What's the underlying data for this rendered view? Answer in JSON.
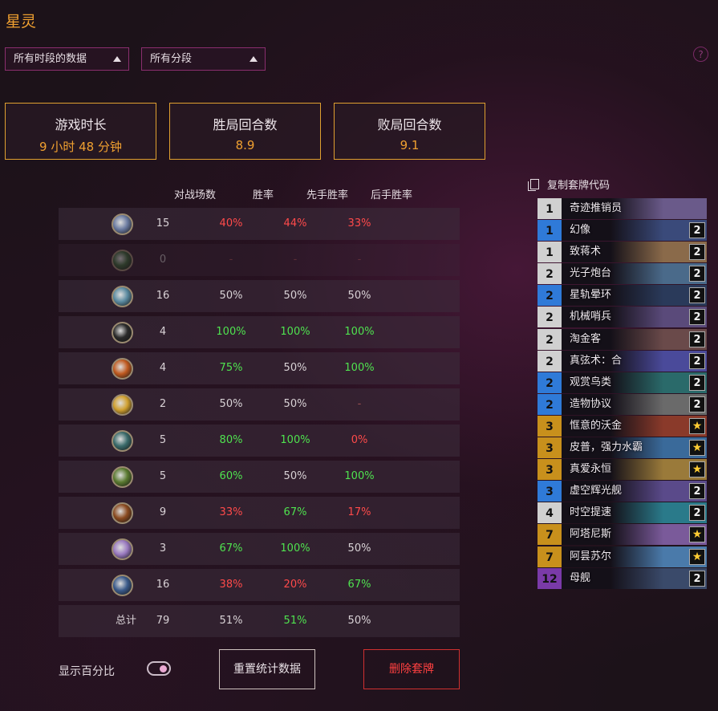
{
  "page": {
    "title": "星灵"
  },
  "filters": {
    "time": "所有时段的数据",
    "rank": "所有分段"
  },
  "help": "?",
  "summary": [
    {
      "label": "游戏时长",
      "value": "9 小时 48 分钟"
    },
    {
      "label": "胜局回合数",
      "value": "8.9"
    },
    {
      "label": "败局回合数",
      "value": "9.1"
    }
  ],
  "table": {
    "headers": {
      "games": "对战场数",
      "winrate": "胜率",
      "first": "先手胜率",
      "second": "后手胜率"
    },
    "rows": [
      {
        "icon": "mage-class-icon",
        "games": "15",
        "winrate": "40%",
        "first": "44%",
        "second": "33%",
        "c": [
          "red",
          "red",
          "red"
        ]
      },
      {
        "icon": "druid-class-icon",
        "games": "0",
        "winrate": "-",
        "first": "-",
        "second": "-",
        "c": [
          "dash",
          "dash",
          "dash"
        ],
        "dim": true
      },
      {
        "icon": "shaman-class-icon",
        "games": "16",
        "winrate": "50%",
        "first": "50%",
        "second": "50%",
        "c": [
          "white",
          "white",
          "white"
        ]
      },
      {
        "icon": "rogue-class-icon",
        "games": "4",
        "winrate": "100%",
        "first": "100%",
        "second": "100%",
        "c": [
          "green",
          "green",
          "green"
        ]
      },
      {
        "icon": "warrior-class-icon",
        "games": "4",
        "winrate": "75%",
        "first": "50%",
        "second": "100%",
        "c": [
          "green",
          "white",
          "green"
        ]
      },
      {
        "icon": "paladin-class-icon",
        "games": "2",
        "winrate": "50%",
        "first": "50%",
        "second": "-",
        "c": [
          "white",
          "white",
          "dash"
        ]
      },
      {
        "icon": "demon-hunter-class-icon",
        "games": "5",
        "winrate": "80%",
        "first": "100%",
        "second": "0%",
        "c": [
          "green",
          "green",
          "red"
        ]
      },
      {
        "icon": "hunter-class-icon",
        "games": "5",
        "winrate": "60%",
        "first": "50%",
        "second": "100%",
        "c": [
          "green",
          "white",
          "green"
        ]
      },
      {
        "icon": "warlock-class-icon",
        "games": "9",
        "winrate": "33%",
        "first": "67%",
        "second": "17%",
        "c": [
          "red",
          "green",
          "red"
        ]
      },
      {
        "icon": "priest-class-icon",
        "games": "3",
        "winrate": "67%",
        "first": "100%",
        "second": "50%",
        "c": [
          "green",
          "green",
          "white"
        ]
      },
      {
        "icon": "death-knight-class-icon",
        "games": "16",
        "winrate": "38%",
        "first": "20%",
        "second": "67%",
        "c": [
          "red",
          "red",
          "green"
        ]
      }
    ],
    "total": {
      "label": "总计",
      "games": "79",
      "winrate": "51%",
      "first": "51%",
      "second": "50%",
      "c": [
        "white",
        "green",
        "white"
      ]
    }
  },
  "deck": {
    "copy_label": "复制套牌代码",
    "cards": [
      {
        "cost": "1",
        "name": "奇迹推销员",
        "count": "",
        "rarity": "common",
        "art": "#6a5a8a"
      },
      {
        "cost": "1",
        "name": "幻像",
        "count": "2",
        "rarity": "rare",
        "art": "#3a4a7a"
      },
      {
        "cost": "1",
        "name": "致蒋术",
        "count": "2",
        "rarity": "common",
        "art": "#8a6a4a"
      },
      {
        "cost": "2",
        "name": "光子炮台",
        "count": "2",
        "rarity": "common",
        "art": "#4a6a8a"
      },
      {
        "cost": "2",
        "name": "星轨晕环",
        "count": "2",
        "rarity": "rare",
        "art": "#2a3a5a"
      },
      {
        "cost": "2",
        "name": "机械哨兵",
        "count": "2",
        "rarity": "common",
        "art": "#5a4a7a"
      },
      {
        "cost": "2",
        "name": "淘金客",
        "count": "2",
        "rarity": "common",
        "art": "#6a4a4a"
      },
      {
        "cost": "2",
        "name": "真弦术：合",
        "count": "2",
        "rarity": "common",
        "art": "#4a4a9a"
      },
      {
        "cost": "2",
        "name": "观赏鸟类",
        "count": "2",
        "rarity": "rare",
        "art": "#2a6a6a"
      },
      {
        "cost": "2",
        "name": "造物协议",
        "count": "2",
        "rarity": "rare",
        "art": "#6a6a6a"
      },
      {
        "cost": "3",
        "name": "恇意的沃金",
        "count": "★",
        "rarity": "legendary",
        "art": "#8a3a2a"
      },
      {
        "cost": "3",
        "name": "皮普，强力水霸",
        "count": "★",
        "rarity": "legendary",
        "art": "#3a6a9a"
      },
      {
        "cost": "3",
        "name": "真爱永恒",
        "count": "★",
        "rarity": "legendary",
        "art": "#9a7a3a"
      },
      {
        "cost": "3",
        "name": "虚空辉光舰",
        "count": "2",
        "rarity": "rare",
        "art": "#5a4a8a"
      },
      {
        "cost": "4",
        "name": "时空提速",
        "count": "2",
        "rarity": "common",
        "art": "#2a7a8a"
      },
      {
        "cost": "7",
        "name": "阿塔尼斯",
        "count": "★",
        "rarity": "legendary",
        "art": "#7a5a9a"
      },
      {
        "cost": "7",
        "name": "阿昙苏尔",
        "count": "★",
        "rarity": "legendary",
        "art": "#4a7aaa"
      },
      {
        "cost": "12",
        "name": "母舰",
        "count": "2",
        "rarity": "epic",
        "art": "#3a4a6a"
      }
    ]
  },
  "footer": {
    "show_pct": "显示百分比",
    "reset": "重置统计数据",
    "delete": "删除套牌"
  },
  "colors": {
    "accent": "#f0a030",
    "win": "#4fe34f",
    "loss": "#ff4a4a"
  }
}
